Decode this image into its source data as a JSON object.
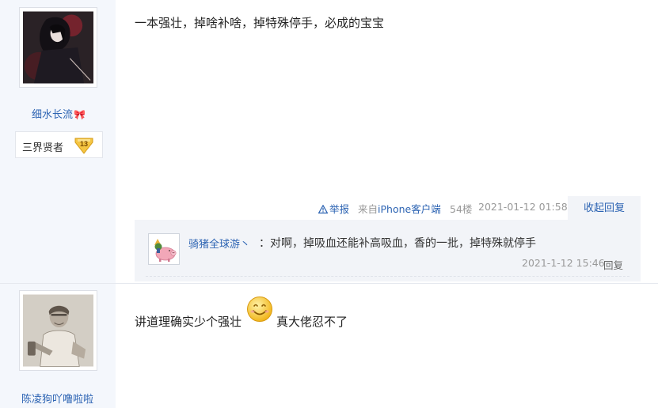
{
  "post1": {
    "author": {
      "name": "细水长流",
      "decoration_icon": "ribbon-bow-icon"
    },
    "rank": {
      "title": "三界贤者",
      "level": "13"
    },
    "content": "一本强壮，掉啥补啥，掉特殊停手，必成的宝宝",
    "footer": {
      "report_label": "举报",
      "client_prefix": "来自",
      "client_name": "iPhone客户端",
      "floor": "54楼",
      "datetime": "2021-01-12 01:58",
      "collapse_label": "收起回复"
    },
    "replies": [
      {
        "user": "骑猪全球游丶",
        "separator": "：",
        "content": "对啊，掉吸血还能补高吸血，香的一批，掉特殊就停手",
        "time": "2021-1-12 15:46",
        "reply_label": "回复"
      }
    ]
  },
  "post2": {
    "author": {
      "name": "陈凌狗吖噜啦啦"
    },
    "content_before": "讲道理确实少个强壮",
    "emoji": "smile-emoji-icon",
    "content_after": "真大佬忍不了"
  },
  "colors": {
    "link_blue": "#2d64b3",
    "meta_gray": "#999999",
    "sidebar_bg": "#f4f7fc",
    "reply_bg": "#f2f4f8",
    "badge_gold": "#f5c542"
  }
}
